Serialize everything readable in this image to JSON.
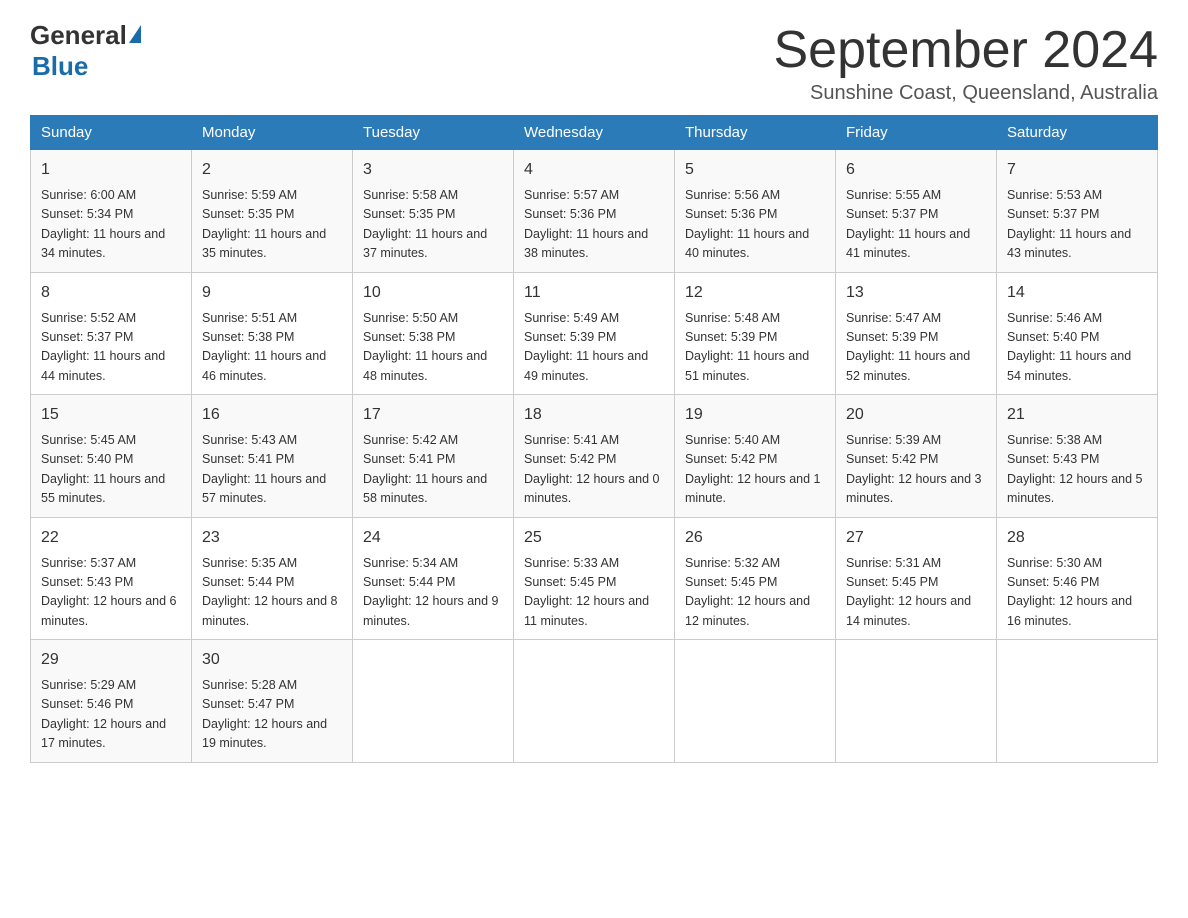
{
  "header": {
    "logo_general": "General",
    "logo_blue": "Blue",
    "month_title": "September 2024",
    "subtitle": "Sunshine Coast, Queensland, Australia"
  },
  "days_of_week": [
    "Sunday",
    "Monday",
    "Tuesday",
    "Wednesday",
    "Thursday",
    "Friday",
    "Saturday"
  ],
  "weeks": [
    [
      {
        "day": "1",
        "sunrise": "6:00 AM",
        "sunset": "5:34 PM",
        "daylight": "11 hours and 34 minutes."
      },
      {
        "day": "2",
        "sunrise": "5:59 AM",
        "sunset": "5:35 PM",
        "daylight": "11 hours and 35 minutes."
      },
      {
        "day": "3",
        "sunrise": "5:58 AM",
        "sunset": "5:35 PM",
        "daylight": "11 hours and 37 minutes."
      },
      {
        "day": "4",
        "sunrise": "5:57 AM",
        "sunset": "5:36 PM",
        "daylight": "11 hours and 38 minutes."
      },
      {
        "day": "5",
        "sunrise": "5:56 AM",
        "sunset": "5:36 PM",
        "daylight": "11 hours and 40 minutes."
      },
      {
        "day": "6",
        "sunrise": "5:55 AM",
        "sunset": "5:37 PM",
        "daylight": "11 hours and 41 minutes."
      },
      {
        "day": "7",
        "sunrise": "5:53 AM",
        "sunset": "5:37 PM",
        "daylight": "11 hours and 43 minutes."
      }
    ],
    [
      {
        "day": "8",
        "sunrise": "5:52 AM",
        "sunset": "5:37 PM",
        "daylight": "11 hours and 44 minutes."
      },
      {
        "day": "9",
        "sunrise": "5:51 AM",
        "sunset": "5:38 PM",
        "daylight": "11 hours and 46 minutes."
      },
      {
        "day": "10",
        "sunrise": "5:50 AM",
        "sunset": "5:38 PM",
        "daylight": "11 hours and 48 minutes."
      },
      {
        "day": "11",
        "sunrise": "5:49 AM",
        "sunset": "5:39 PM",
        "daylight": "11 hours and 49 minutes."
      },
      {
        "day": "12",
        "sunrise": "5:48 AM",
        "sunset": "5:39 PM",
        "daylight": "11 hours and 51 minutes."
      },
      {
        "day": "13",
        "sunrise": "5:47 AM",
        "sunset": "5:39 PM",
        "daylight": "11 hours and 52 minutes."
      },
      {
        "day": "14",
        "sunrise": "5:46 AM",
        "sunset": "5:40 PM",
        "daylight": "11 hours and 54 minutes."
      }
    ],
    [
      {
        "day": "15",
        "sunrise": "5:45 AM",
        "sunset": "5:40 PM",
        "daylight": "11 hours and 55 minutes."
      },
      {
        "day": "16",
        "sunrise": "5:43 AM",
        "sunset": "5:41 PM",
        "daylight": "11 hours and 57 minutes."
      },
      {
        "day": "17",
        "sunrise": "5:42 AM",
        "sunset": "5:41 PM",
        "daylight": "11 hours and 58 minutes."
      },
      {
        "day": "18",
        "sunrise": "5:41 AM",
        "sunset": "5:42 PM",
        "daylight": "12 hours and 0 minutes."
      },
      {
        "day": "19",
        "sunrise": "5:40 AM",
        "sunset": "5:42 PM",
        "daylight": "12 hours and 1 minute."
      },
      {
        "day": "20",
        "sunrise": "5:39 AM",
        "sunset": "5:42 PM",
        "daylight": "12 hours and 3 minutes."
      },
      {
        "day": "21",
        "sunrise": "5:38 AM",
        "sunset": "5:43 PM",
        "daylight": "12 hours and 5 minutes."
      }
    ],
    [
      {
        "day": "22",
        "sunrise": "5:37 AM",
        "sunset": "5:43 PM",
        "daylight": "12 hours and 6 minutes."
      },
      {
        "day": "23",
        "sunrise": "5:35 AM",
        "sunset": "5:44 PM",
        "daylight": "12 hours and 8 minutes."
      },
      {
        "day": "24",
        "sunrise": "5:34 AM",
        "sunset": "5:44 PM",
        "daylight": "12 hours and 9 minutes."
      },
      {
        "day": "25",
        "sunrise": "5:33 AM",
        "sunset": "5:45 PM",
        "daylight": "12 hours and 11 minutes."
      },
      {
        "day": "26",
        "sunrise": "5:32 AM",
        "sunset": "5:45 PM",
        "daylight": "12 hours and 12 minutes."
      },
      {
        "day": "27",
        "sunrise": "5:31 AM",
        "sunset": "5:45 PM",
        "daylight": "12 hours and 14 minutes."
      },
      {
        "day": "28",
        "sunrise": "5:30 AM",
        "sunset": "5:46 PM",
        "daylight": "12 hours and 16 minutes."
      }
    ],
    [
      {
        "day": "29",
        "sunrise": "5:29 AM",
        "sunset": "5:46 PM",
        "daylight": "12 hours and 17 minutes."
      },
      {
        "day": "30",
        "sunrise": "5:28 AM",
        "sunset": "5:47 PM",
        "daylight": "12 hours and 19 minutes."
      },
      null,
      null,
      null,
      null,
      null
    ]
  ]
}
